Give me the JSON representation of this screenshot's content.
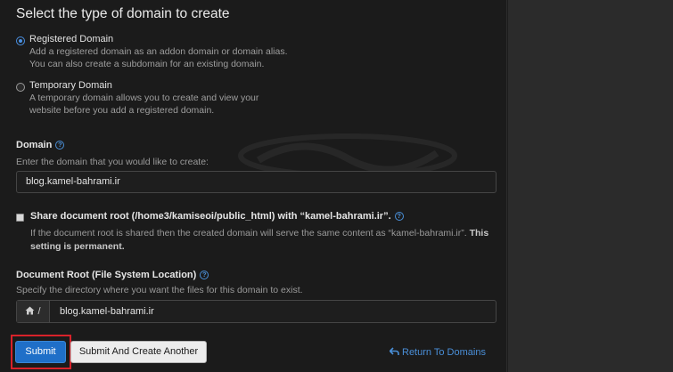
{
  "heading": "Select the type of domain to create",
  "domain_type": {
    "registered": {
      "label": "Registered Domain",
      "desc_line1": "Add a registered domain as an addon domain or domain alias.",
      "desc_line2": "You can also create a subdomain for an existing domain.",
      "checked": true
    },
    "temporary": {
      "label": "Temporary Domain",
      "desc_line1": "A temporary domain allows you to create and view your",
      "desc_line2": "website before you add a registered domain.",
      "checked": false
    }
  },
  "domain": {
    "label": "Domain",
    "hint": "Enter the domain that you would like to create:",
    "value": "blog.kamel-bahrami.ir"
  },
  "share_root": {
    "label": "Share document root (/home3/kamiseoi/public_html) with “kamel-bahrami.ir”.",
    "desc": "If the document root is shared then the created domain will serve the same content as “kamel-bahrami.ir”.",
    "desc_bold": "This setting is permanent.",
    "checked": false
  },
  "doc_root": {
    "label": "Document Root (File System Location)",
    "hint": "Specify the directory where you want the files for this domain to exist.",
    "prefix": "/",
    "value": "blog.kamel-bahrami.ir"
  },
  "buttons": {
    "submit": "Submit",
    "submit_another": "Submit And Create Another",
    "return": "Return To Domains"
  },
  "colors": {
    "accent": "#1f6fc8",
    "link": "#4a8fd8",
    "highlight": "#d8222a"
  }
}
